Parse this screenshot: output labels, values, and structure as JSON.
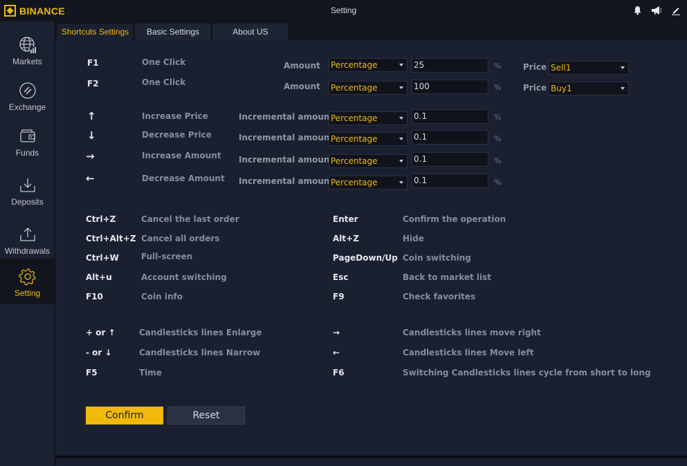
{
  "app": {
    "logo_text": "BINANCE",
    "window_title": "Setting",
    "brand_color": "#f0b90b",
    "titlebar_icons": [
      "bell-icon",
      "megaphone-icon",
      "edit-icon"
    ]
  },
  "sidebar": {
    "items": [
      {
        "label": "Markets",
        "icon": "markets-globe-icon"
      },
      {
        "label": "Exchange",
        "icon": "exchange-icon"
      },
      {
        "label": "Funds",
        "icon": "wallet-icon"
      },
      {
        "label": "Deposits",
        "icon": "download-tray-icon"
      },
      {
        "label": "Withdrawals",
        "icon": "upload-tray-icon"
      },
      {
        "label": "Setting",
        "icon": "gear-icon",
        "active": true
      }
    ]
  },
  "tabs": [
    {
      "label": "Shortcuts Settings",
      "active": true
    },
    {
      "label": "Basic Settings"
    },
    {
      "label": "About US"
    }
  ],
  "order_rows": [
    {
      "key": "F1",
      "desc": "One Click",
      "field_label": "Amount",
      "type": "Percentage",
      "value": "25",
      "unit": "%",
      "price_label": "Price",
      "price": "Sell1"
    },
    {
      "key": "F2",
      "desc": "One Click",
      "field_label": "Amount",
      "type": "Percentage",
      "value": "100",
      "unit": "%",
      "price_label": "Price",
      "price": "Buy1"
    }
  ],
  "arrow_rows": [
    {
      "key": "↑",
      "desc": "Increase Price",
      "field_label": "Incremental amount",
      "type": "Percentage",
      "value": "0.1",
      "unit": "%"
    },
    {
      "key": "↓",
      "desc": "Decrease Price",
      "field_label": "Incremental amount",
      "type": "Percentage",
      "value": "0.1",
      "unit": "%"
    },
    {
      "key": "→",
      "desc": "Increase Amount",
      "field_label": "Incremental amount",
      "type": "Percentage",
      "value": "0.1",
      "unit": "%"
    },
    {
      "key": "←",
      "desc": "Decrease Amount",
      "field_label": "Incremental amount",
      "type": "Percentage",
      "value": "0.1",
      "unit": "%"
    }
  ],
  "shortcuts_left": [
    {
      "key": "Ctrl+Z",
      "desc": "Cancel the last order"
    },
    {
      "key": "Ctrl+Alt+Z",
      "desc": "Cancel all orders"
    },
    {
      "key": "Ctrl+W",
      "desc": "Full-screen"
    },
    {
      "key": "Alt+u",
      "desc": "Account switching"
    },
    {
      "key": "F10",
      "desc": "Coin info"
    }
  ],
  "shortcuts_right": [
    {
      "key": "Enter",
      "desc": "Confirm the operation"
    },
    {
      "key": "Alt+Z",
      "desc": "Hide"
    },
    {
      "key": "PageDown/Up",
      "desc": "Coin switching"
    },
    {
      "key": "Esc",
      "desc": "Back to market list"
    },
    {
      "key": "F9",
      "desc": "Check favorites"
    }
  ],
  "candle_left": [
    {
      "key": "+ or ↑",
      "desc": "Candlesticks lines Enlarge"
    },
    {
      "key": "- or ↓",
      "desc": "Candlesticks lines Narrow"
    },
    {
      "key": "F5",
      "desc": "Time"
    }
  ],
  "candle_right": [
    {
      "key": "→",
      "desc": "Candlesticks lines move right"
    },
    {
      "key": "←",
      "desc": "Candlesticks lines Move left"
    },
    {
      "key": "F6",
      "desc": "Switching Candlesticks lines cycle from short to long"
    }
  ],
  "buttons": {
    "confirm": "Confirm",
    "reset": "Reset"
  }
}
